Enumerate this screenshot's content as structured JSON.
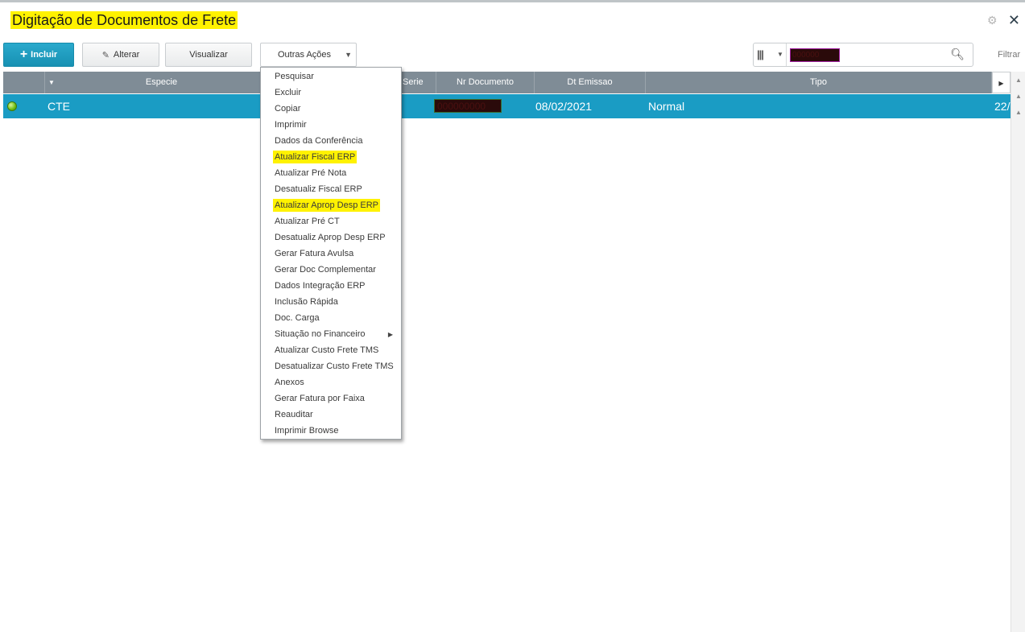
{
  "window": {
    "title": "Digitação de Documentos de Frete",
    "icons": [
      "gear-icon",
      "close-icon"
    ]
  },
  "toolbar": {
    "incluir": {
      "prefix": "+",
      "label": "Incluir"
    },
    "alterar": {
      "label": "Alterar",
      "icon": "pencil-icon"
    },
    "visualizar": {
      "label": "Visualizar"
    },
    "outras_acoes": {
      "label": "Outras Ações",
      "icon": "caret-down-icon"
    }
  },
  "search": {
    "columns_icon": "columns-icon",
    "redacted_value": "000000",
    "search_icon": "magnifier-icon",
    "filter_label": "Filtrar"
  },
  "grid": {
    "columns": [
      "Especie",
      "Serie",
      "Nr Documento",
      "Dt Emissao",
      "Tipo"
    ],
    "rows": [
      {
        "status": "green",
        "especie": "CTE",
        "nr_documento": "000000000",
        "dt_emissao": "08/02/2021",
        "tipo": "Normal",
        "truncated": "22/"
      }
    ]
  },
  "menu": {
    "items": [
      {
        "label": "Pesquisar",
        "highlight": false
      },
      {
        "label": "Excluir",
        "highlight": false
      },
      {
        "label": "Copiar",
        "highlight": false
      },
      {
        "label": "Imprimir",
        "highlight": false
      },
      {
        "label": "Dados da Conferência",
        "highlight": false
      },
      {
        "label": "Atualizar Fiscal ERP",
        "highlight": true
      },
      {
        "label": "Atualizar Pré Nota",
        "highlight": false
      },
      {
        "label": "Desatualiz Fiscal ERP",
        "highlight": false
      },
      {
        "label": "Atualizar Aprop Desp ERP",
        "highlight": true
      },
      {
        "label": "Atualizar Pré CT",
        "highlight": false
      },
      {
        "label": "Desatualiz Aprop Desp ERP",
        "highlight": false
      },
      {
        "label": "Gerar Fatura Avulsa",
        "highlight": false
      },
      {
        "label": "Gerar Doc Complementar",
        "highlight": false
      },
      {
        "label": "Dados Integração ERP",
        "highlight": false
      },
      {
        "label": "Inclusão Rápida",
        "highlight": false
      },
      {
        "label": "Doc. Carga",
        "highlight": false
      },
      {
        "label": "Situação no Financeiro",
        "highlight": false,
        "submenu": true
      },
      {
        "label": "Atualizar Custo Frete TMS",
        "highlight": false
      },
      {
        "label": "Desatualizar Custo Frete TMS",
        "highlight": false
      },
      {
        "label": "Anexos",
        "highlight": false
      },
      {
        "label": "Gerar Fatura por Faixa",
        "highlight": false
      },
      {
        "label": "Reauditar",
        "highlight": false
      },
      {
        "label": "Imprimir Browse",
        "highlight": false
      }
    ]
  },
  "colors": {
    "primary": "#1791b3",
    "header": "#7f8c96",
    "selected_row": "#1a9cc4",
    "highlight": "#fff200"
  }
}
